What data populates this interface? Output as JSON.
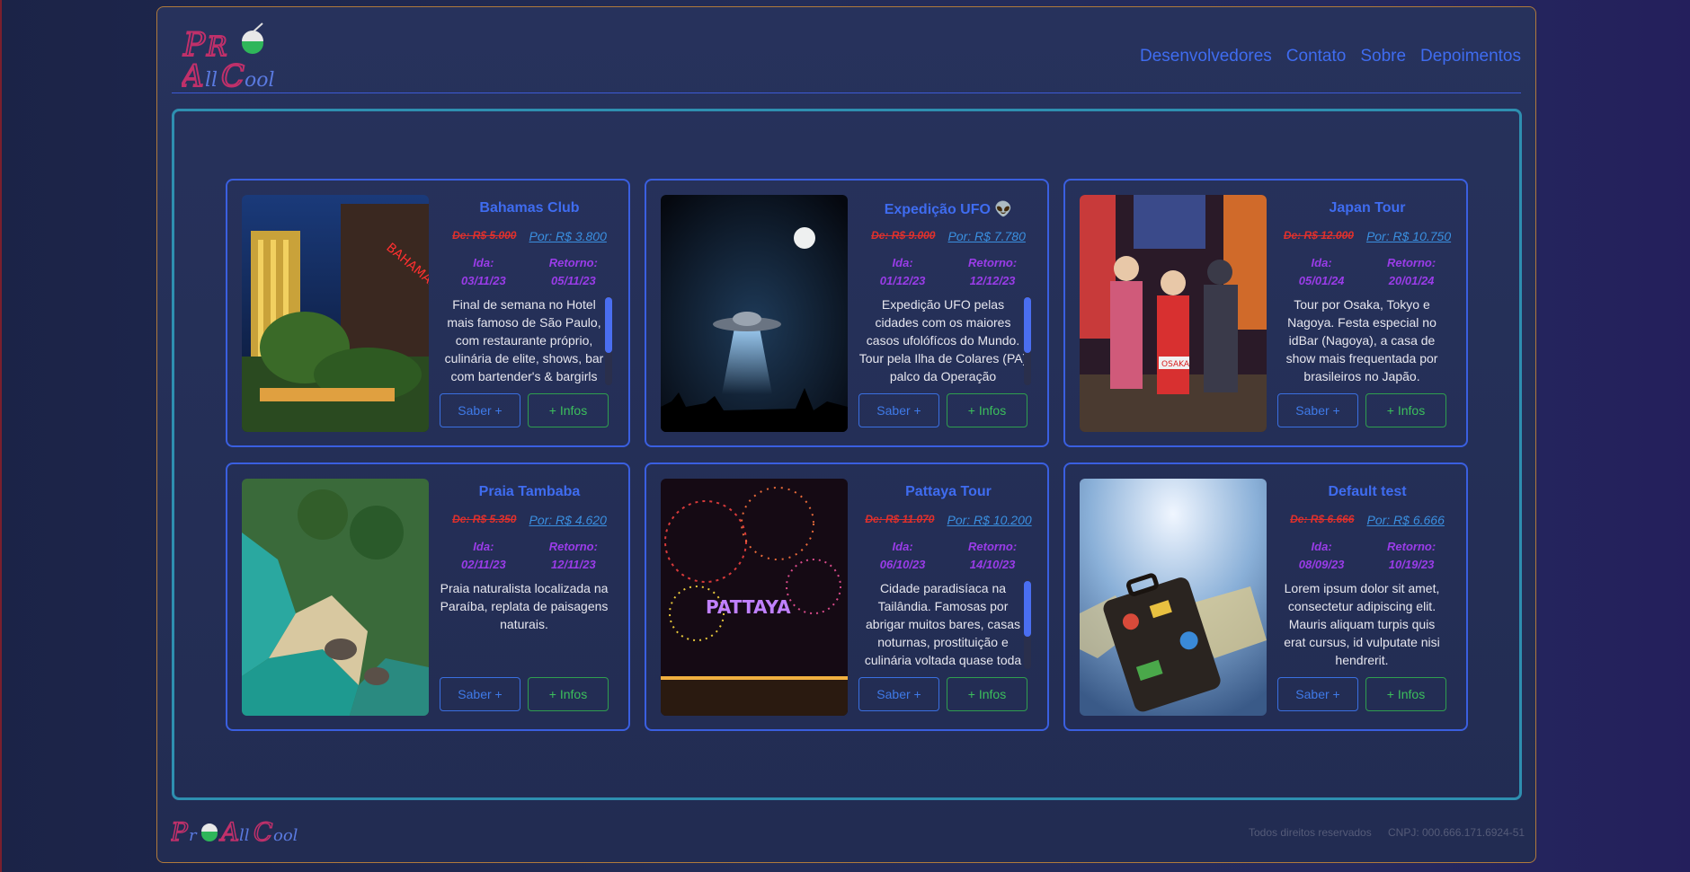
{
  "header": {
    "logo_icon": "proallcool-logo",
    "nav": [
      "Desenvolvedores",
      "Contato",
      "Sobre",
      "Depoimentos"
    ]
  },
  "cards": [
    {
      "title": "Bahamas Club",
      "old_price": "De: R$ 5.000",
      "new_price": "Por: R$ 3.800",
      "ida_label": "Ida:",
      "ida": "03/11/23",
      "retorno_label": "Retorno:",
      "retorno": "05/11/23",
      "description": "Final de semana no Hotel mais famoso de São Paulo, com restaurante próprio, culinária de elite, shows, bar com bartender's & bargirls",
      "saber": "Saber +",
      "infos": "+ Infos",
      "image_icon": "hotel-night-photo"
    },
    {
      "title": "Expedição UFO 👽",
      "old_price": "De: R$ 9.000",
      "new_price": "Por: R$ 7.780",
      "ida_label": "Ida:",
      "ida": "01/12/23",
      "retorno_label": "Retorno:",
      "retorno": "12/12/23",
      "description": "Expedição UFO pelas cidades com os maiores casos ufolófícos do Mundo. Tour pela Ilha de Colares (PA) palco da Operação",
      "saber": "Saber +",
      "infos": "+ Infos",
      "image_icon": "ufo-night-photo"
    },
    {
      "title": "Japan Tour",
      "old_price": "De: R$ 12.000",
      "new_price": "Por: R$ 10.750",
      "ida_label": "Ida:",
      "ida": "05/01/24",
      "retorno_label": "Retorno:",
      "retorno": "20/01/24",
      "description": "Tour por Osaka, Tokyo e Nagoya. Festa especial no idBar (Nagoya), a casa de show mais frequentada por brasileiros no Japão.",
      "saber": "Saber +",
      "infos": "+ Infos",
      "image_icon": "osaka-street-photo"
    },
    {
      "title": "Praia Tambaba",
      "old_price": "De: R$ 5.350",
      "new_price": "Por: R$ 4.620",
      "ida_label": "Ida:",
      "ida": "02/11/23",
      "retorno_label": "Retorno:",
      "retorno": "12/11/23",
      "description": "Praia naturalista localizada na Paraíba, replata de paisagens naturais.",
      "saber": "Saber +",
      "infos": "+ Infos",
      "image_icon": "beach-aerial-photo"
    },
    {
      "title": "Pattaya Tour",
      "old_price": "De: R$ 11.070",
      "new_price": "Por: R$ 10.200",
      "ida_label": "Ida:",
      "ida": "06/10/23",
      "retorno_label": "Retorno:",
      "retorno": "14/10/23",
      "description": "Cidade paradisíaca na Tailândia. Famosas por abrigar muitos bares, casas noturnas, prostituição e culinária voltada quase toda",
      "saber": "Saber +",
      "infos": "+ Infos",
      "image_icon": "fireworks-photo"
    },
    {
      "title": "Default test",
      "old_price": "De: R$ 6.666",
      "new_price": "Por: R$ 6.666",
      "ida_label": "Ida:",
      "ida": "08/09/23",
      "retorno_label": "Retorno:",
      "retorno": "10/19/23",
      "description": "Lorem ipsum dolor sit amet, consectetur adipiscing elit. Mauris aliquam turpis quis erat cursus, id vulputate nisi hendrerit.",
      "saber": "Saber +",
      "infos": "+ Infos",
      "image_icon": "suitcase-map-photo"
    }
  ],
  "footer": {
    "rights": "Todos direitos reservados",
    "cnpj": "CNPJ: 000.666.171.6924-51"
  },
  "colors": {
    "accent": "#3f6cf0",
    "date": "#9a3ce8",
    "old_price": "#e0302c",
    "infos": "#3cbf5c"
  }
}
